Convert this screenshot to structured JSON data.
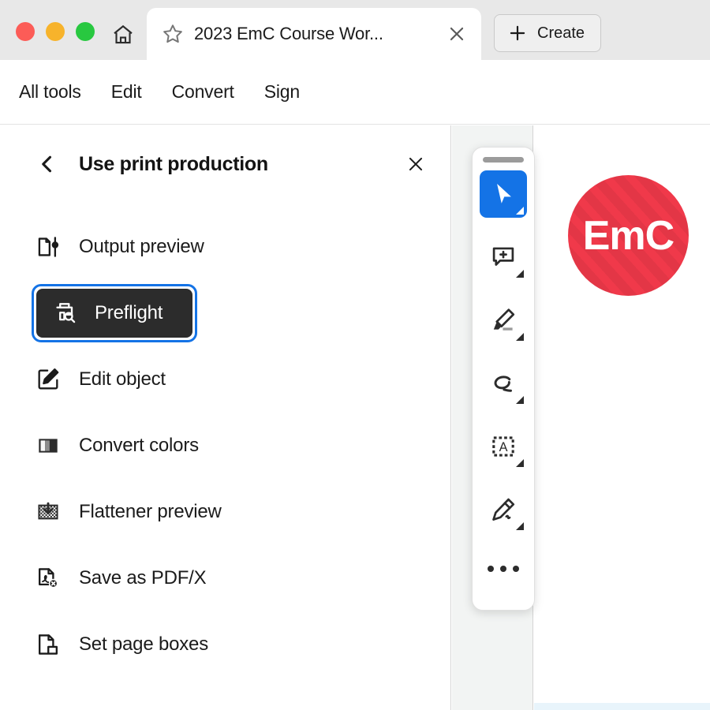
{
  "window": {
    "traffic_lights": [
      {
        "name": "close",
        "color": "#fc5c57"
      },
      {
        "name": "minimize",
        "color": "#f7b32b"
      },
      {
        "name": "maximize",
        "color": "#28c840"
      }
    ],
    "home_icon": "home-icon"
  },
  "tab": {
    "star_icon": "star-icon",
    "title": "2023 EmC Course Wor...",
    "close_icon": "close-icon"
  },
  "create": {
    "label": "Create",
    "plus_icon": "plus-icon"
  },
  "menubar": {
    "items": [
      {
        "label": "All tools"
      },
      {
        "label": "Edit"
      },
      {
        "label": "Convert"
      },
      {
        "label": "Sign"
      }
    ]
  },
  "panel": {
    "back_icon": "chevron-left-icon",
    "title": "Use print production",
    "close_icon": "close-icon",
    "tools": [
      {
        "label": "Output preview",
        "icon": "output-preview-icon",
        "selected": false
      },
      {
        "label": "Preflight",
        "icon": "preflight-icon",
        "selected": true
      },
      {
        "label": "Edit object",
        "icon": "edit-object-icon",
        "selected": false
      },
      {
        "label": "Convert colors",
        "icon": "convert-colors-icon",
        "selected": false
      },
      {
        "label": "Flattener preview",
        "icon": "flattener-preview-icon",
        "selected": false
      },
      {
        "label": "Save as PDF/X",
        "icon": "save-as-pdfx-icon",
        "selected": false
      },
      {
        "label": "Set page boxes",
        "icon": "set-page-boxes-icon",
        "selected": false
      }
    ]
  },
  "floating_toolbar": {
    "grip": "drag-handle",
    "buttons": [
      {
        "name": "select-tool",
        "icon": "cursor-arrow-icon",
        "active": true
      },
      {
        "name": "comment-tool",
        "icon": "add-comment-icon",
        "active": false
      },
      {
        "name": "highlight-tool",
        "icon": "highlighter-icon",
        "active": false
      },
      {
        "name": "draw-tool",
        "icon": "draw-lasso-icon",
        "active": false
      },
      {
        "name": "add-text-tool",
        "icon": "add-text-box-icon",
        "active": false
      },
      {
        "name": "fill-sign-tool",
        "icon": "pen-nib-sign-icon",
        "active": false
      }
    ],
    "more_icon": "more-options-icon"
  },
  "document": {
    "logo": {
      "text": "EmC",
      "color": "#f0394a"
    }
  },
  "colors": {
    "accent_blue": "#1473e6",
    "selected_dark": "#2c2c2c",
    "titlebar_gray": "#e8e8e8",
    "gutter_gray": "#f2f4f3"
  }
}
